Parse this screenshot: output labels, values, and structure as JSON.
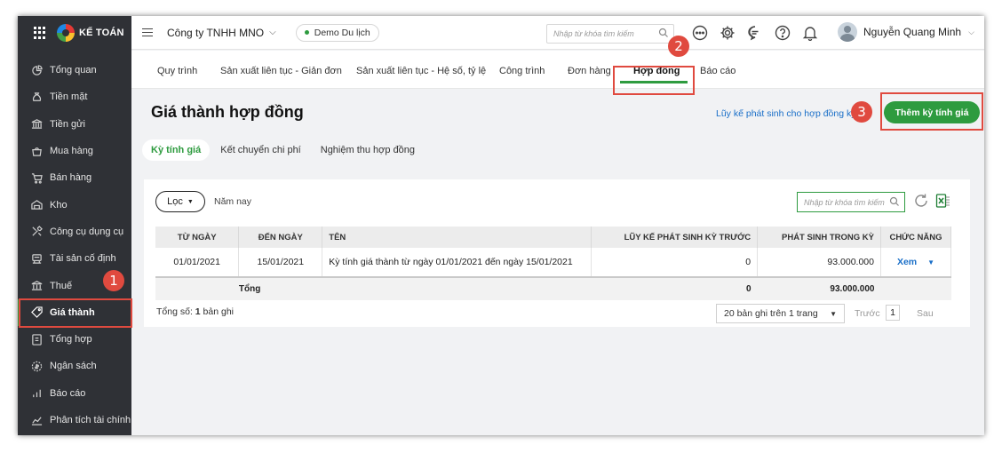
{
  "brand": "KẾ TOÁN",
  "sidebar": {
    "items": [
      {
        "label": "Tổng quan",
        "icon": "dashboard-icon"
      },
      {
        "label": "Tiền mặt",
        "icon": "cash-bag-icon"
      },
      {
        "label": "Tiền gửi",
        "icon": "bank-icon"
      },
      {
        "label": "Mua hàng",
        "icon": "shopping-bag-icon"
      },
      {
        "label": "Bán hàng",
        "icon": "cart-icon"
      },
      {
        "label": "Kho",
        "icon": "warehouse-icon"
      },
      {
        "label": "Công cụ dụng cụ",
        "icon": "tools-icon"
      },
      {
        "label": "Tài sản cố định",
        "icon": "fixed-asset-icon"
      },
      {
        "label": "Thuế",
        "icon": "tax-icon"
      },
      {
        "label": "Giá thành",
        "icon": "price-tag-icon"
      },
      {
        "label": "Tổng hợp",
        "icon": "summary-icon"
      },
      {
        "label": "Ngân sách",
        "icon": "budget-icon"
      },
      {
        "label": "Báo cáo",
        "icon": "report-chart-icon"
      },
      {
        "label": "Phân tích tài chính",
        "icon": "analytics-icon"
      }
    ],
    "active_index": 9
  },
  "topbar": {
    "company": "Công ty TNHH MNO",
    "demo_label": "Demo Du lịch",
    "search_placeholder": "Nhập từ khóa tìm kiếm",
    "user_name": "Nguyễn Quang Minh"
  },
  "module_tabs": [
    "Quy trình",
    "Sản xuất liên tục - Giản đơn",
    "Sản xuất liên tục - Hệ số, tỷ lệ",
    "Công trình",
    "Đơn hàng",
    "Hợp đồng",
    "Báo cáo"
  ],
  "active_module_tab": "Hợp đồng",
  "page": {
    "title": "Giá thành hợp đồng",
    "link_label": "Lũy kế phát sinh cho hợp đồng kỳ",
    "add_button": "Thêm kỳ tính giá"
  },
  "sub_tabs": [
    "Kỳ tính giá",
    "Kết chuyển chi phí",
    "Nghiệm thu hợp đồng"
  ],
  "filter": {
    "button": "Lọc",
    "period": "Năm nay",
    "search_placeholder": "Nhập từ khóa tìm kiếm"
  },
  "table": {
    "columns": [
      "TỪ NGÀY",
      "ĐẾN NGÀY",
      "TÊN",
      "LŨY KẾ PHÁT SINH KỲ TRƯỚC",
      "PHÁT SINH TRONG KỲ",
      "CHỨC NĂNG"
    ],
    "rows": [
      {
        "from": "01/01/2021",
        "to": "15/01/2021",
        "name": "Kỳ tính giá thành từ ngày 01/01/2021 đến ngày 15/01/2021",
        "prev": "0",
        "current": "93.000.000",
        "action": "Xem"
      }
    ],
    "total": {
      "label": "Tổng",
      "prev": "0",
      "current": "93.000.000"
    }
  },
  "pager": {
    "total_prefix": "Tổng số:",
    "total_count": "1",
    "total_suffix": "bản ghi",
    "per_page": "20 bản ghi trên 1 trang",
    "prev": "Trước",
    "page": "1",
    "next": "Sau"
  },
  "annotations": {
    "badge1": "1",
    "badge2": "2",
    "badge3": "3"
  },
  "colors": {
    "accent": "#2e9b3f",
    "sidebar_bg": "#2f3136",
    "annotation": "#e04a3f",
    "link": "#1a6fc8"
  }
}
